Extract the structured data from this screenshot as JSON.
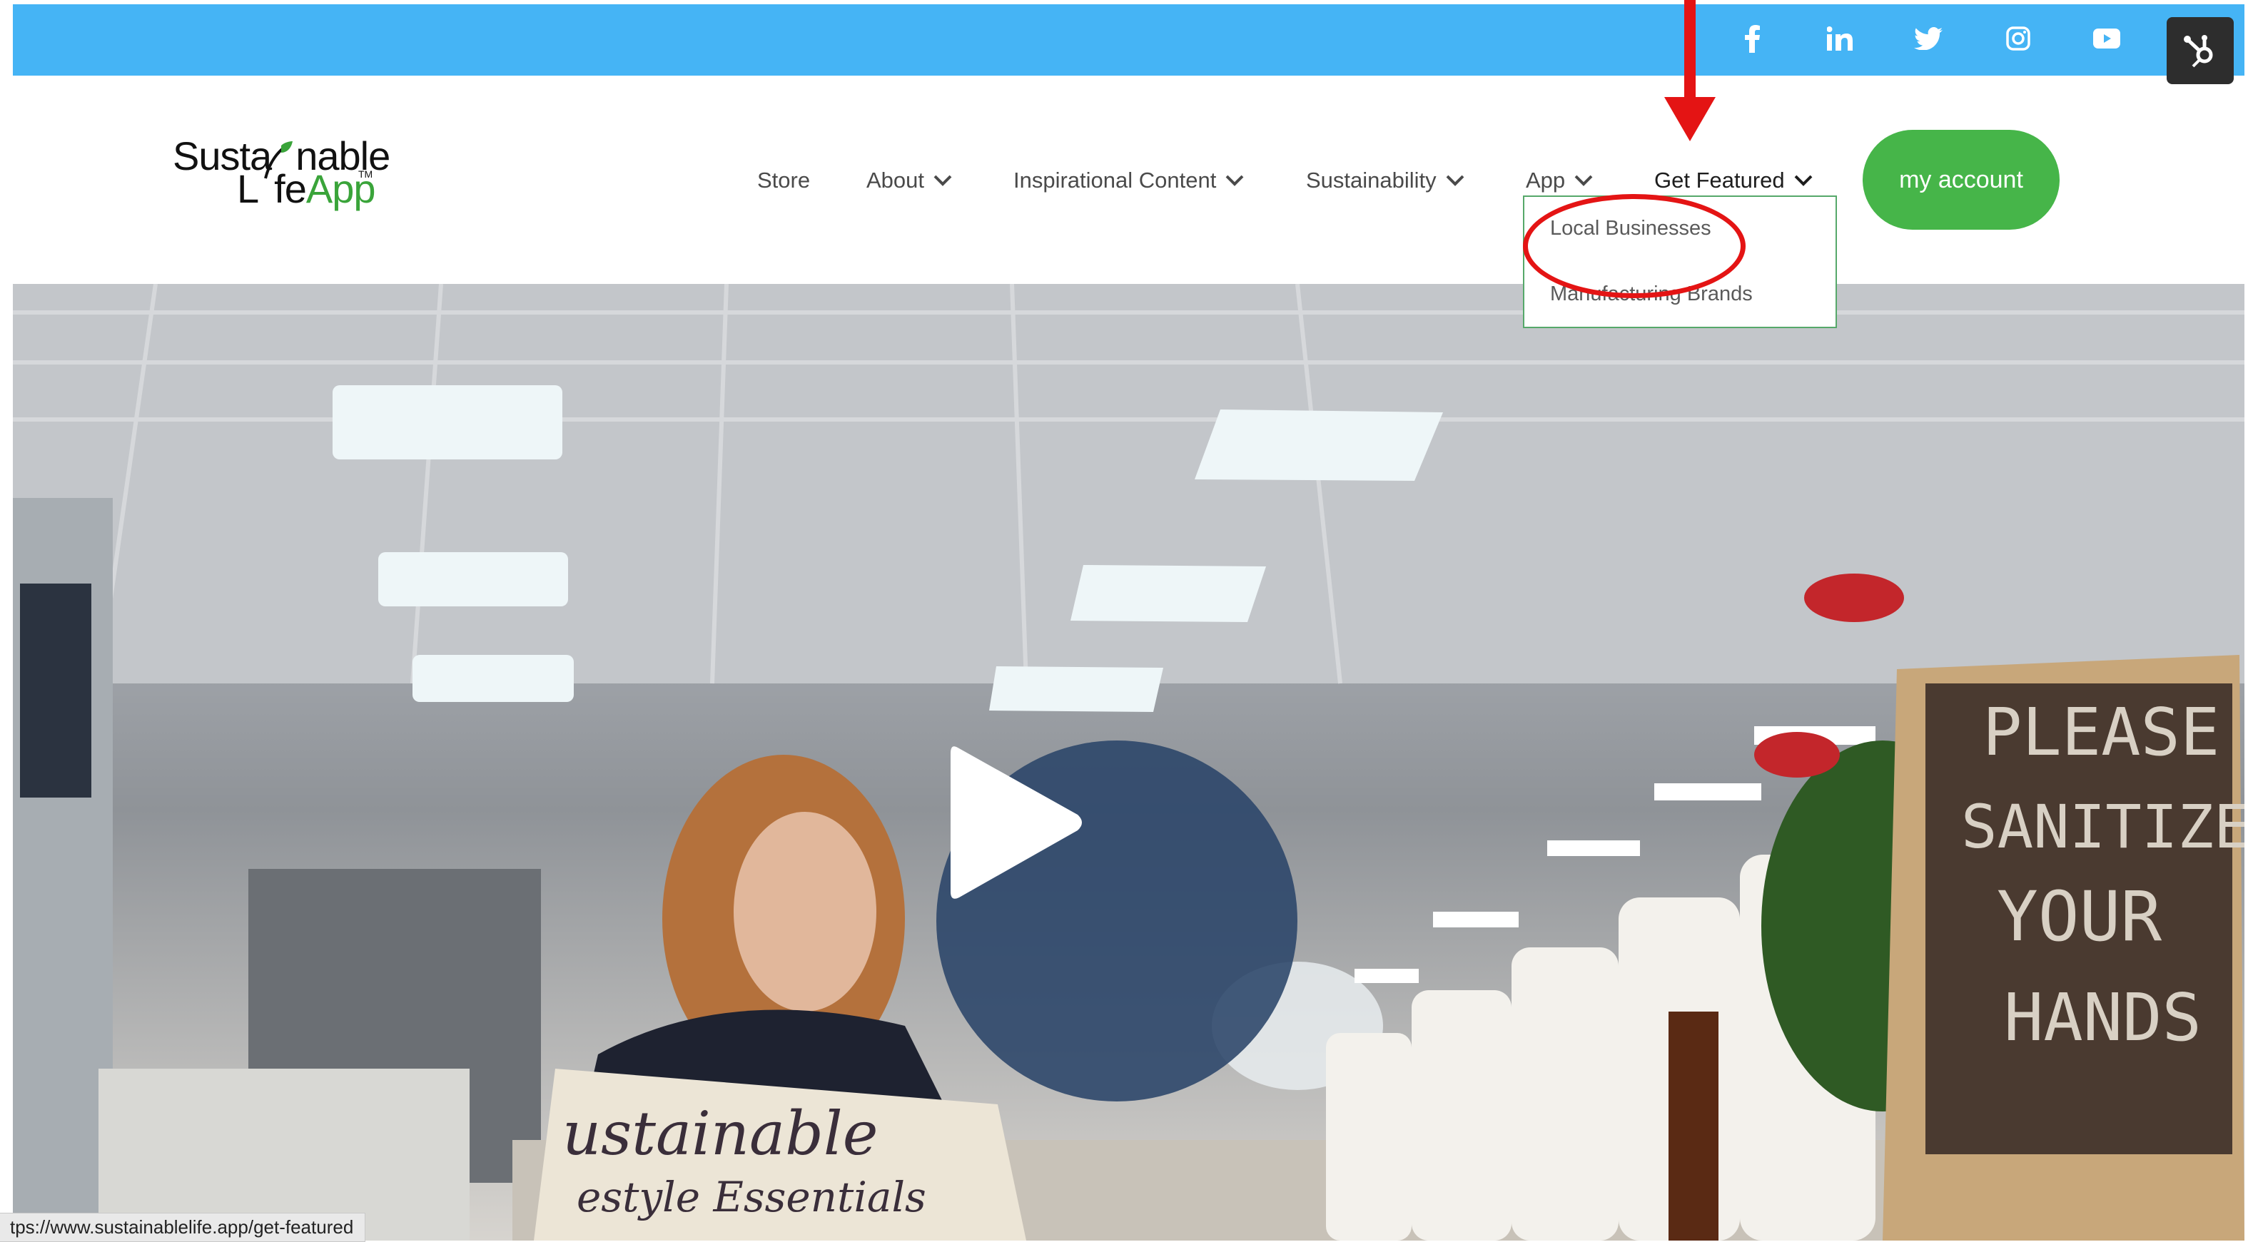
{
  "social_bar": {
    "icons": [
      "facebook-icon",
      "linkedin-icon",
      "twitter-icon",
      "instagram-icon",
      "youtube-icon"
    ],
    "hubspot_icon": "hubspot-sprocket-icon",
    "bar_color": "#45b4f5"
  },
  "logo": {
    "line1": "Susta",
    "line1b": "nable",
    "line2a": "L",
    "line2b": "fe",
    "line2c": "App",
    "tm": "TM"
  },
  "nav": {
    "store": "Store",
    "about": "About",
    "inspirational": "Inspirational Content",
    "sustainability": "Sustainability",
    "app": "App",
    "get_featured": "Get Featured"
  },
  "account_button": "my account",
  "dropdown": {
    "items": [
      "Local Businesses",
      "Manufacturing Brands"
    ]
  },
  "hero": {
    "sign_text": [
      "PLEASE",
      "SANITIZE",
      "YOUR",
      "HANDS"
    ],
    "bag_text": [
      "ustainable",
      "estyle Essentials"
    ],
    "play_icon": "play-icon"
  },
  "status_bar": {
    "url": "tps://www.sustainablelife.app/get-featured"
  },
  "colors": {
    "accent_green": "#46b549",
    "annotation_red": "#e41414",
    "play_button": "#2a4469"
  }
}
